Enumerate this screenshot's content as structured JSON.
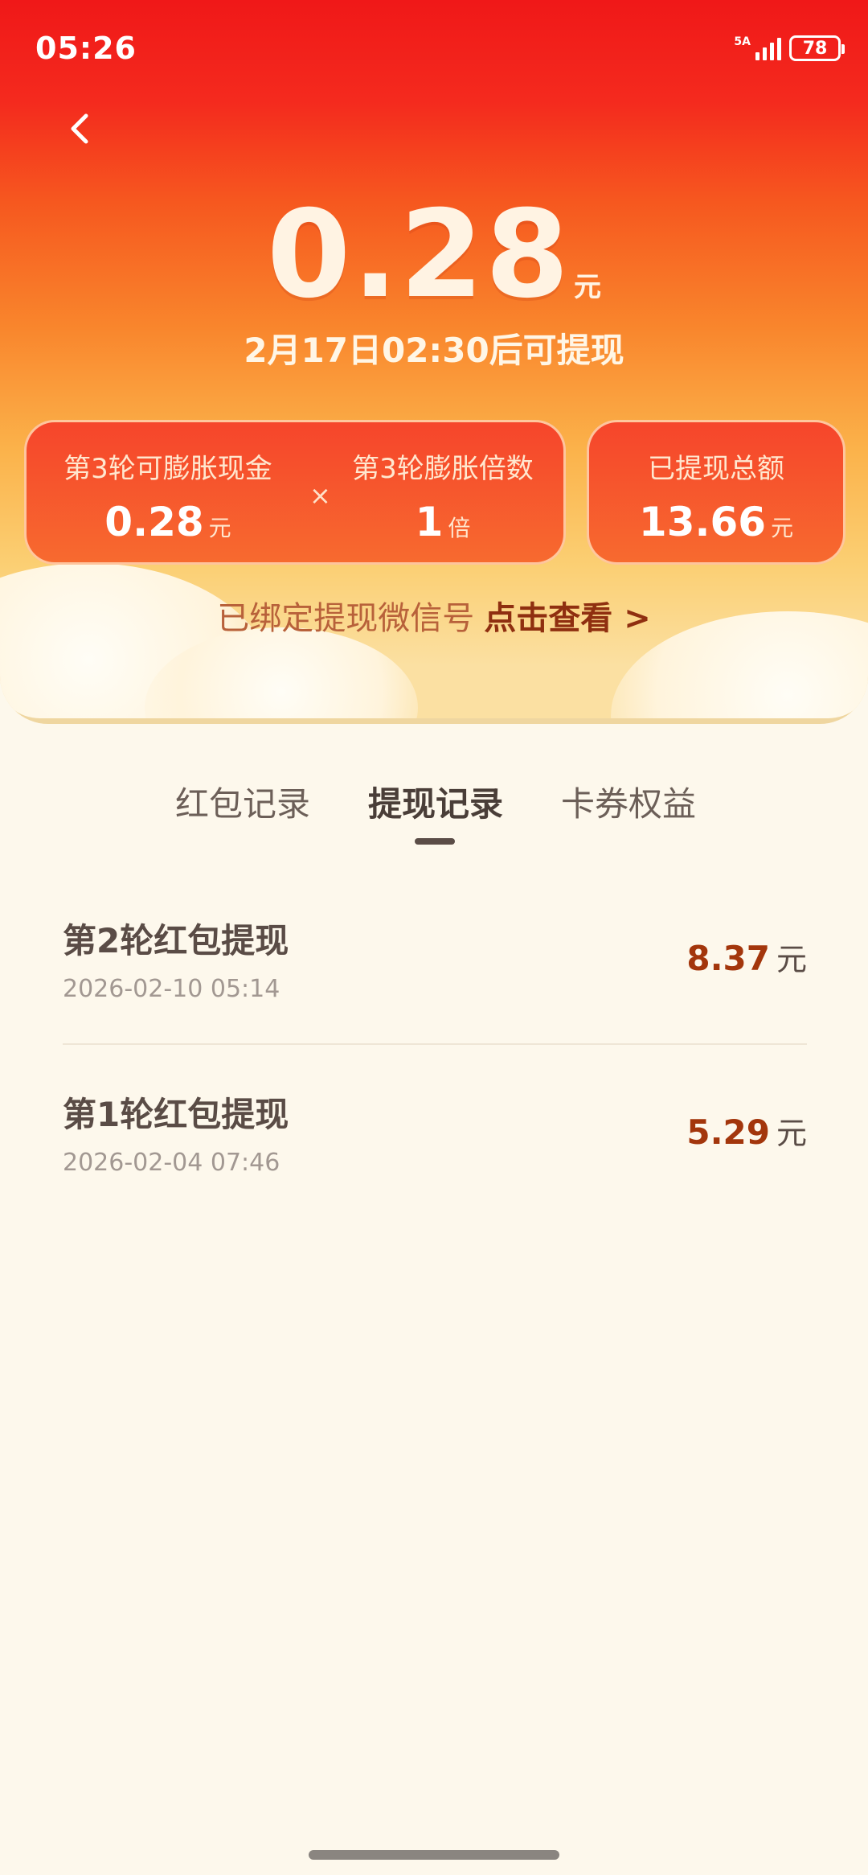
{
  "status_bar": {
    "time": "05:26",
    "network": "5A",
    "battery": "78"
  },
  "header": {
    "amount": "0.28",
    "amount_unit": "元",
    "withdraw_time": "2月17日02:30后可提现"
  },
  "stats": {
    "round_cash_label": "第3轮可膨胀现金",
    "round_cash_value": "0.28",
    "round_cash_unit": "元",
    "times_symbol": "×",
    "multiplier_label": "第3轮膨胀倍数",
    "multiplier_value": "1",
    "multiplier_unit": "倍",
    "total_label": "已提现总额",
    "total_value": "13.66",
    "total_unit": "元"
  },
  "wechat": {
    "text": "已绑定提现微信号",
    "link": "点击查看 >"
  },
  "tabs": [
    {
      "label": "红包记录",
      "active": false
    },
    {
      "label": "提现记录",
      "active": true
    },
    {
      "label": "卡券权益",
      "active": false
    }
  ],
  "records": [
    {
      "title": "第2轮红包提现",
      "date": "2026-02-10 05:14",
      "amount": "8.37",
      "unit": "元"
    },
    {
      "title": "第1轮红包提现",
      "date": "2026-02-04 07:46",
      "amount": "5.29",
      "unit": "元"
    }
  ]
}
